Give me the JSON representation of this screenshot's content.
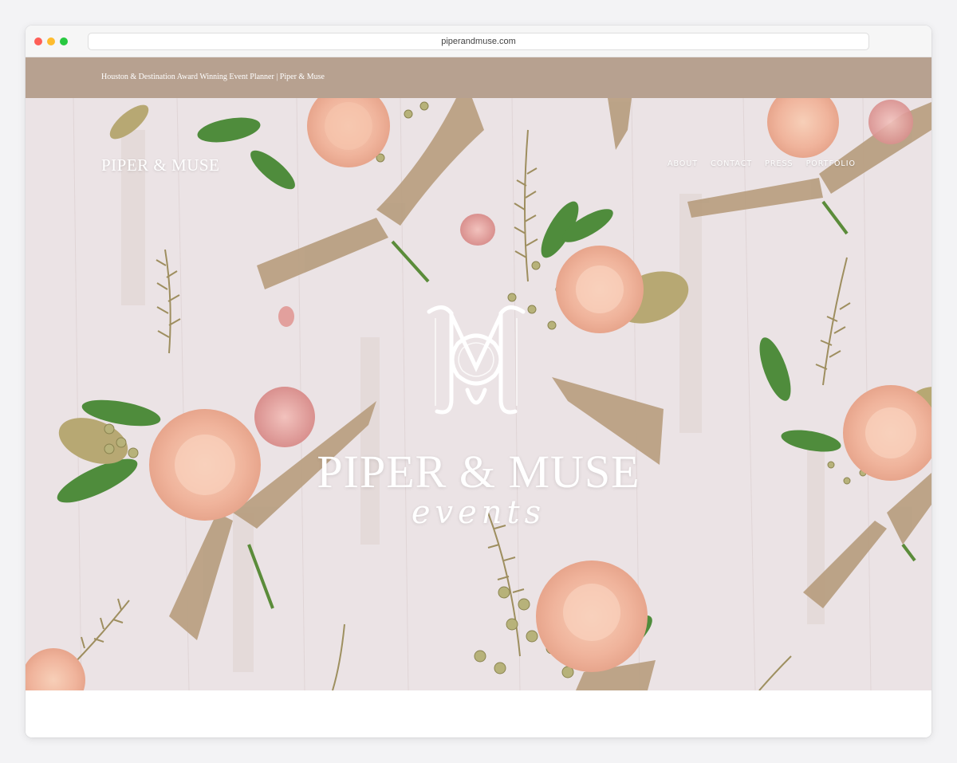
{
  "browser": {
    "url": "piperandmuse.com"
  },
  "topbar": {
    "title": "Houston & Destination Award Winning Event Planner | Piper & Muse"
  },
  "header": {
    "brand": "PIPER & MUSE",
    "nav": [
      "ABOUT",
      "CONTACT",
      "PRESS",
      "PORTFOLIO"
    ]
  },
  "hero": {
    "title": "PIPER & MUSE",
    "subtitle": "events",
    "monogram_icon": "pm-monogram-icon"
  },
  "colors": {
    "topbar": "#b7a190",
    "background": "#ece4e6",
    "peach": "#f3b9a0",
    "leaf": "#4a8a3a",
    "ribbon": "#b69c7f"
  }
}
